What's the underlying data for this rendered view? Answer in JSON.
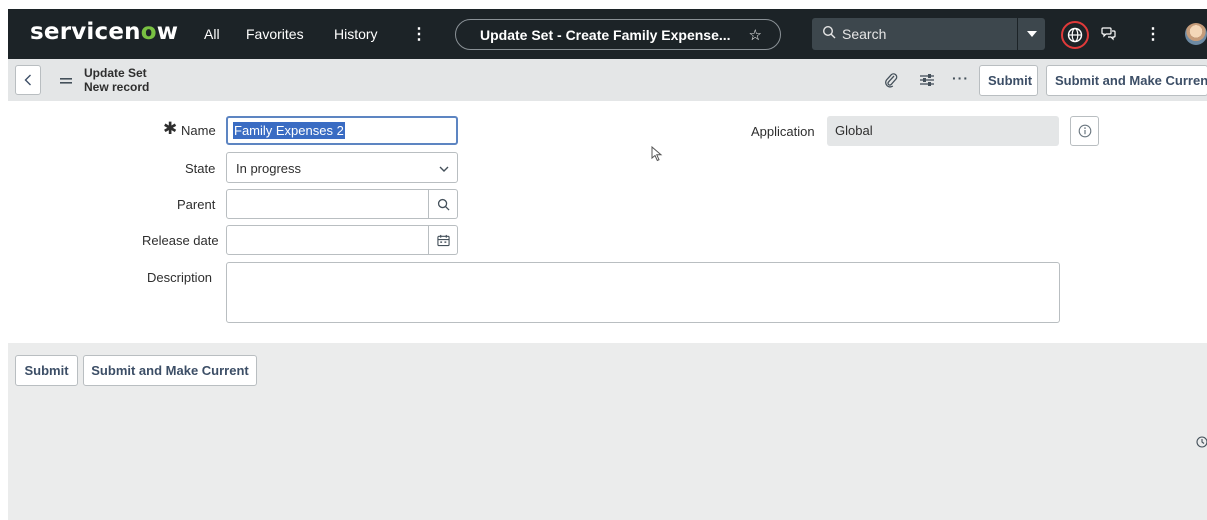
{
  "topnav": {
    "logo_text_a": "servicen",
    "logo_text_o": "o",
    "logo_text_b": "w",
    "nav_all": "All",
    "nav_favorites": "Favorites",
    "nav_history": "History",
    "nav_more": "⋮",
    "context_title": "Update Set - Create Family Expense...",
    "context_star": "☆",
    "search_placeholder": "Search",
    "more_dots": "⋮",
    "brand_color": "#1c2327",
    "logo_accent": "#79c142"
  },
  "header": {
    "title_line1": "Update Set",
    "title_line2": "New record",
    "more_dots": "···",
    "submit_label": "Submit",
    "submit_current_label": "Submit and Make Current"
  },
  "form": {
    "name_label": "Name",
    "required_marker": "✱",
    "name_value": "Family Expenses 2",
    "state_label": "State",
    "state_value": "In progress",
    "parent_label": "Parent",
    "release_label": "Release date",
    "description_label": "Description",
    "application_label": "Application",
    "application_value": "Global"
  },
  "footer": {
    "submit_label": "Submit",
    "submit_current_label": "Submit and Make Current"
  }
}
